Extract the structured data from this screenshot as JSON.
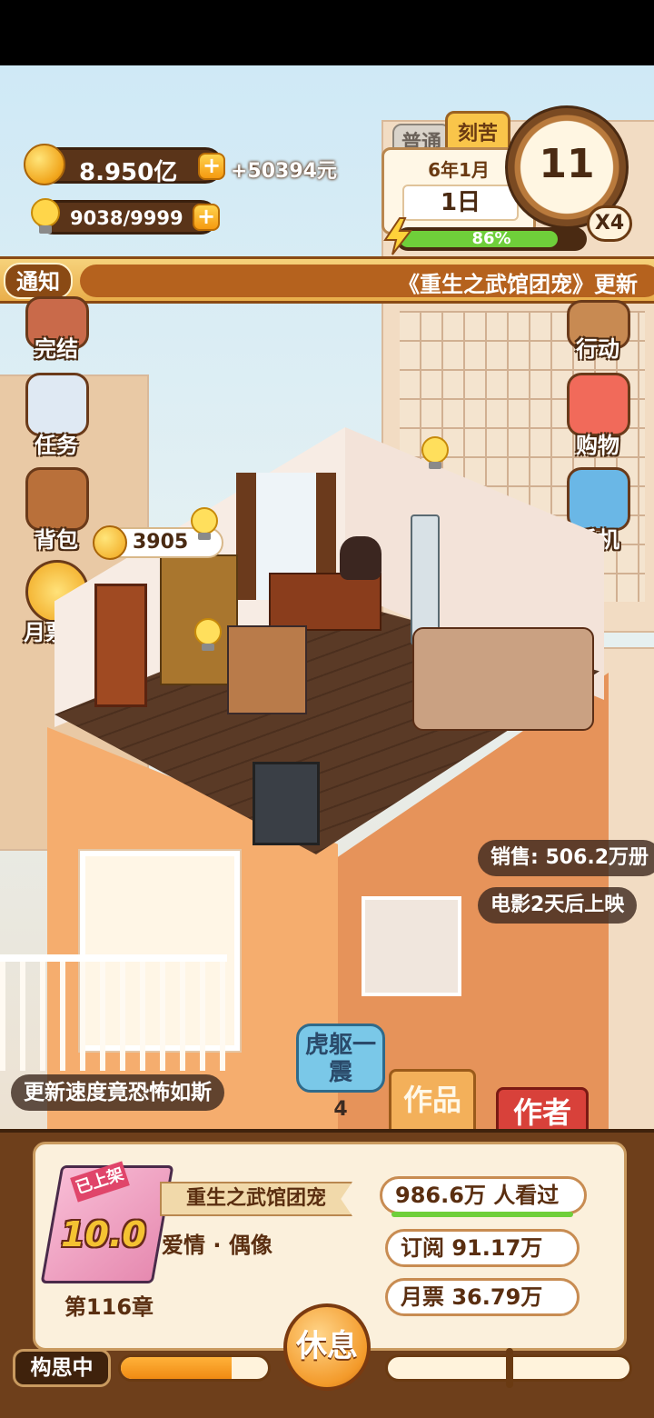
{
  "currency": {
    "coins": "8.950亿",
    "coins_income": "+50394元",
    "inspiration": "9038/9999"
  },
  "mode_tabs": {
    "normal": "普通",
    "hard": "刻苦"
  },
  "date": {
    "year_month": "6年1月",
    "day": "1日",
    "hour": "11",
    "speed": "X4",
    "energy_percent": "86%",
    "energy_value": 0.86
  },
  "notice": {
    "tag": "通知",
    "text": "《重生之武馆团宠》更新"
  },
  "left_menu": [
    {
      "label": "完结",
      "icon": "book-icon"
    },
    {
      "label": "任务",
      "icon": "checklist-icon"
    },
    {
      "label": "背包",
      "icon": "bag-icon"
    },
    {
      "label": "月票榜",
      "icon": "medal-icon"
    }
  ],
  "right_menu": [
    {
      "label": "行动",
      "icon": "door-icon"
    },
    {
      "label": "购物",
      "icon": "shop-icon"
    },
    {
      "label": "手机",
      "icon": "phone-icon"
    }
  ],
  "room": {
    "coin_value": "3905"
  },
  "info": {
    "sales": "销售: 506.2万册",
    "movie": "电影2天后上映"
  },
  "event": {
    "badge": "虎躯一震",
    "badge_count": "4",
    "slogan": "更新速度竟恐怖如斯"
  },
  "tabs": {
    "works": "作品",
    "author": "作者"
  },
  "book": {
    "status_ribbon": "已上架",
    "score": "10.0",
    "title": "重生之武馆团宠",
    "genre": "爱情 · 偶像",
    "chapter": "第116章",
    "views": "986.6万 人看过",
    "subscriptions": "订阅 91.17万",
    "monthly_tickets": "月票 36.79万"
  },
  "footer": {
    "status": "构思中",
    "rest_button": "休息",
    "progress": 0.75
  },
  "colors": {
    "panel_brown": "#6e3f1b",
    "energy_green": "#6fcf3a",
    "notice_brown": "#8a4a14",
    "author_red": "#d8413a"
  }
}
